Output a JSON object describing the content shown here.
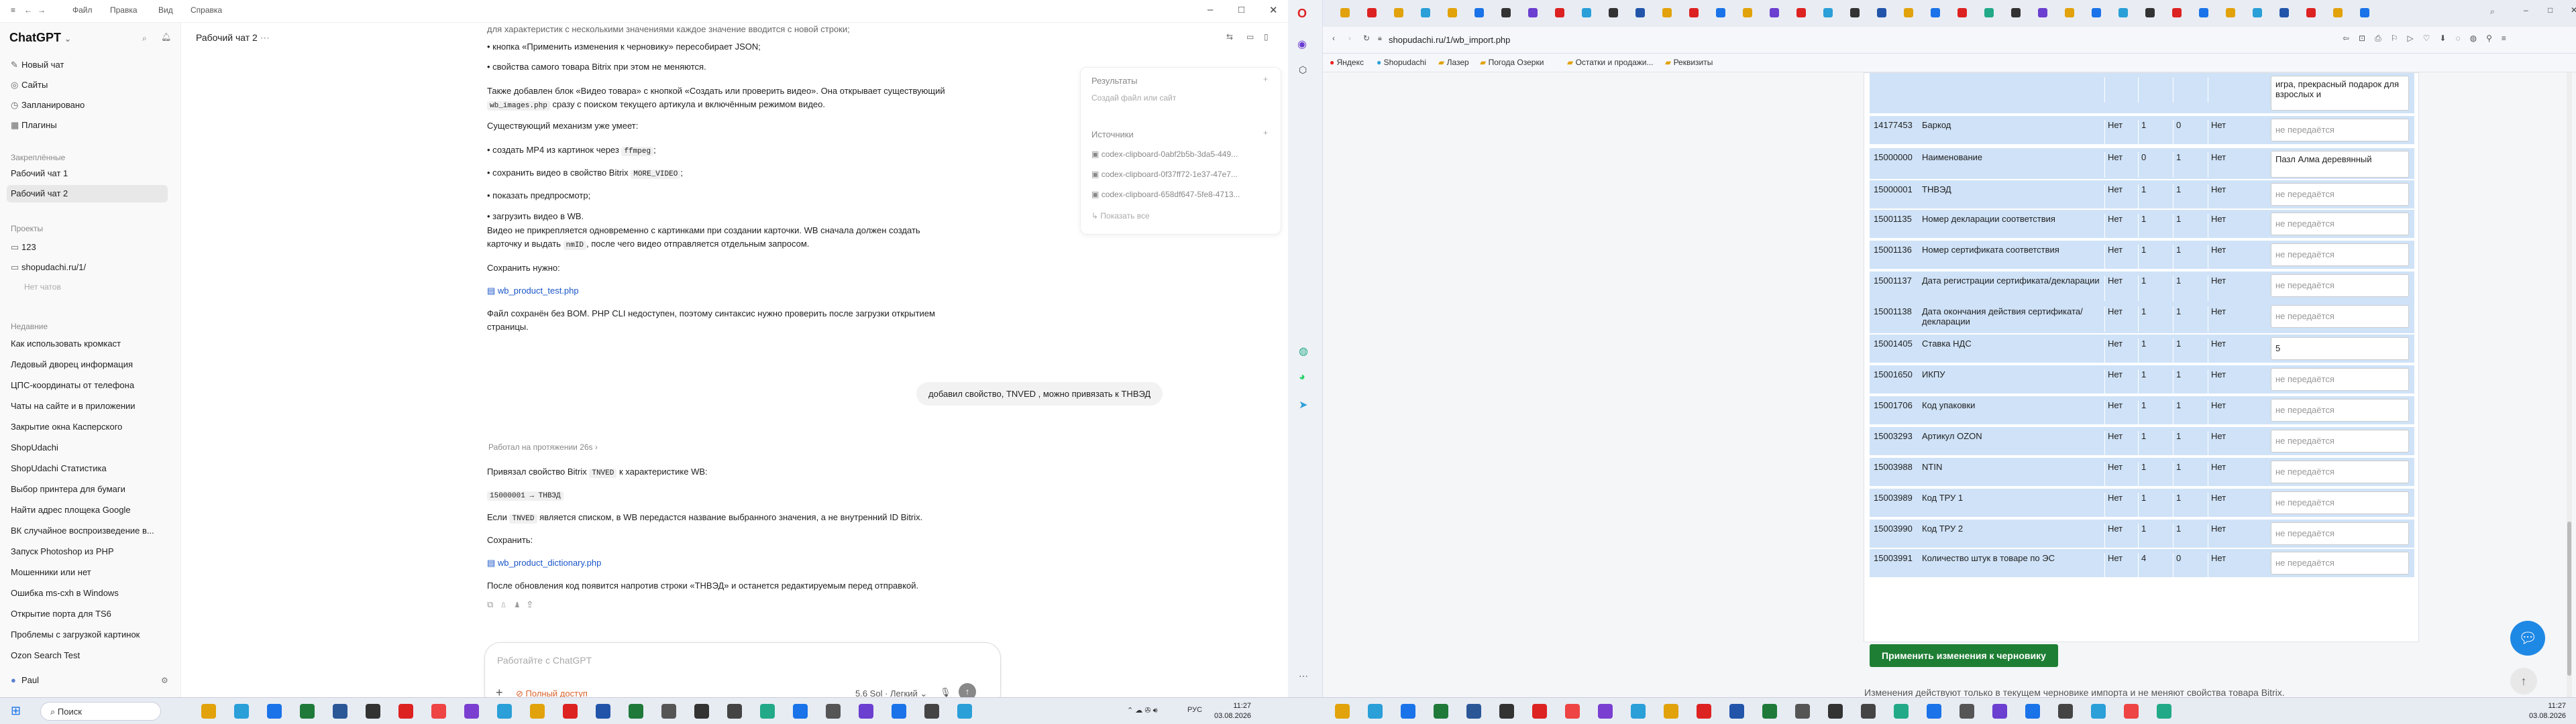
{
  "chat": {
    "app_title": "ChatGPT",
    "menu": [
      "Файл",
      "Правка",
      "Вид",
      "Справка"
    ],
    "sidebar": {
      "logo": "ChatGPT",
      "items": [
        {
          "label": "Новый чат"
        },
        {
          "label": "Сайты"
        },
        {
          "label": "Запланировано"
        },
        {
          "label": "Плагины"
        }
      ],
      "pinned_title": "Закреплённые",
      "pinned": [
        {
          "label": "Рабочий чат 1"
        },
        {
          "label": "Рабочий чат 2"
        }
      ],
      "projects_title": "Проекты",
      "projects": [
        {
          "label": "123"
        },
        {
          "label": "shopudachi.ru/1/"
        }
      ],
      "projects_empty": "Нет чатов",
      "recent_title": "Недавние",
      "recent": [
        "Как использовать кромкаст",
        "Ледовый дворец информация",
        "ЦПС-координаты от телефона",
        "Чаты на сайте и в приложении",
        "Закрытие окна Касперского",
        "ShopUdachi",
        "ShopUdachi Статистика",
        "Выбор принтера для бумаги",
        "Найти адрес площека Google",
        "ВК случайное воспроизведение в...",
        "Запуск Photoshop из PHP",
        "Мошенники или нет",
        "Ошибка ms-cxh в Windows",
        "Открытие порта для TS6",
        "Проблемы с загрузкой картинок",
        "Ozon Search Test"
      ],
      "user": "Paul"
    },
    "header_title": "Рабочий чат 2",
    "messages": {
      "top_line": "для характеристик с несколькими значениями каждое значение вводится с новой строки;",
      "bullets1": [
        "кнопка «Применить изменения к черновику» пересобирает JSON;",
        "свойства самого товара Bitrix при этом не меняются."
      ],
      "para1a": "Также добавлен блок «Видео товара» с кнопкой «Создать или проверить видео». Она открывает существующий",
      "para1b_code": "wb_images.php",
      "para1b_text": " сразу с поиском текущего артикула и включённым режимом видео.",
      "para2": "Существующий механизм уже умеет:",
      "bullets2": [
        {
          "text": "создать MP4 из картинок через ",
          "code": "ffmpeg",
          "tail": ";"
        },
        {
          "text": "сохранить видео в свойство Bitrix ",
          "code": "MORE_VIDEO",
          "tail": ";"
        },
        {
          "text": "показать предпросмотр;",
          "code": "",
          "tail": ""
        },
        {
          "text": "загрузить видео в WB.",
          "code": "",
          "tail": ""
        }
      ],
      "para3a": "Видео не прикрепляется одновременно с картинками при создании карточки. WB сначала должен создать",
      "para3b_pre": "карточку и выдать ",
      "para3b_code": "nmID",
      "para3b_post": ", после чего видео отправляется отдельным запросом.",
      "saved_label": "Сохранить нужно:",
      "file1": "wb_product_test.php",
      "para4": "Файл сохранён без BOM. PHP CLI недоступен, поэтому синтаксис нужно проверить после загрузки открытием страницы.",
      "user_message": "добавил свойство, TNVED , можно привязать к ТНВЭД",
      "worked": "Работал на протяжении 26s",
      "reply1_pre": "Привязал свойство Bitrix ",
      "reply1_code": "TNVED",
      "reply1_post": " к характеристике WB:",
      "reply_code_block": "15000001 → ТНВЭД",
      "reply2_pre": "Если ",
      "reply2_code": "TNVED",
      "reply2_post": " является списком, в WB передастся название выбранного значения, а не внутренний ID Bitrix.",
      "saved_label2": "Сохранить:",
      "file2": "wb_product_dictionary.php",
      "reply3": "После обновления код появится напротив строки «ТНВЭД» и останется редактируемым перед отправкой."
    },
    "composer": {
      "placeholder": "Работайте с ChatGPT",
      "access": "Полный доступ",
      "model": "5.6 Sol · Легкий"
    },
    "right_panel": {
      "results_title": "Результаты",
      "results_hint": "Создай файл или сайт",
      "sources_title": "Источники",
      "sources": [
        "codex-clipboard-0abf2b5b-3da5-449...",
        "codex-clipboard-0f37ff72-1e37-47e7...",
        "codex-clipboard-658df647-5fe8-4713..."
      ],
      "show_all": "Показать все"
    }
  },
  "browser": {
    "url": "shopudachi.ru/1/wb_import.php",
    "bookmarks": [
      "Яндекс",
      "Shopudachi",
      "Лазер",
      "Погода Озерки",
      "Остатки и продажи...",
      "Реквизиты"
    ],
    "table": {
      "rows": [
        {
          "id": "",
          "name": "",
          "req": "",
          "a": "",
          "b": "",
          "c": "",
          "value": "игра, прекрасный подарок для взрослых и",
          "kind": "multi"
        },
        {
          "id": "14177453",
          "name": "Баркод",
          "req": "Нет",
          "a": "1",
          "b": "0",
          "c": "Нет",
          "value": "не передаётся",
          "kind": "empty"
        },
        {
          "id": "15000000",
          "name": "Наименование",
          "req": "Нет",
          "a": "0",
          "b": "1",
          "c": "Нет",
          "value": "Пазл Алма деревянный",
          "kind": "multi"
        },
        {
          "id": "15000001",
          "name": "ТНВЭД",
          "req": "Нет",
          "a": "1",
          "b": "1",
          "c": "Нет",
          "value": "не передаётся",
          "kind": "empty"
        },
        {
          "id": "15001135",
          "name": "Номер декларации соответствия",
          "req": "Нет",
          "a": "1",
          "b": "1",
          "c": "Нет",
          "value": "не передаётся",
          "kind": "empty"
        },
        {
          "id": "15001136",
          "name": "Номер сертификата соответствия",
          "req": "Нет",
          "a": "1",
          "b": "1",
          "c": "Нет",
          "value": "не передаётся",
          "kind": "empty"
        },
        {
          "id": "15001137",
          "name": "Дата регистрации сертификата/декларации",
          "req": "Нет",
          "a": "1",
          "b": "1",
          "c": "Нет",
          "value": "не передаётся",
          "kind": "empty"
        },
        {
          "id": "15001138",
          "name": "Дата окончания действия сертификата/декларации",
          "req": "Нет",
          "a": "1",
          "b": "1",
          "c": "Нет",
          "value": "не передаётся",
          "kind": "empty"
        },
        {
          "id": "15001405",
          "name": "Ставка НДС",
          "req": "Нет",
          "a": "1",
          "b": "1",
          "c": "Нет",
          "value": "5",
          "kind": "filled"
        },
        {
          "id": "15001650",
          "name": "ИКПУ",
          "req": "Нет",
          "a": "1",
          "b": "1",
          "c": "Нет",
          "value": "не передаётся",
          "kind": "empty"
        },
        {
          "id": "15001706",
          "name": "Код упаковки",
          "req": "Нет",
          "a": "1",
          "b": "1",
          "c": "Нет",
          "value": "не передаётся",
          "kind": "empty"
        },
        {
          "id": "15003293",
          "name": "Артикул OZON",
          "req": "Нет",
          "a": "1",
          "b": "1",
          "c": "Нет",
          "value": "не передаётся",
          "kind": "empty"
        },
        {
          "id": "15003988",
          "name": "NTIN",
          "req": "Нет",
          "a": "1",
          "b": "1",
          "c": "Нет",
          "value": "не передаётся",
          "kind": "empty"
        },
        {
          "id": "15003989",
          "name": "Код ТРУ 1",
          "req": "Нет",
          "a": "1",
          "b": "1",
          "c": "Нет",
          "value": "не передаётся",
          "kind": "empty"
        },
        {
          "id": "15003990",
          "name": "Код ТРУ 2",
          "req": "Нет",
          "a": "1",
          "b": "1",
          "c": "Нет",
          "value": "не передаётся",
          "kind": "empty"
        },
        {
          "id": "15003991",
          "name": "Количество штук в товаре по ЭС",
          "req": "Нет",
          "a": "4",
          "b": "0",
          "c": "Нет",
          "value": "не передаётся",
          "kind": "empty"
        }
      ]
    },
    "apply_button": "Применить изменения к черновику",
    "note": "Изменения действуют только в текущем черновике импорта и не меняют свойства товара Bitrix."
  },
  "taskbar": {
    "search": "Поиск",
    "lang": "РУС",
    "time_left": "11:27",
    "date_left": "03.08.2026",
    "time_right": "11:27",
    "date_right": "03.08.2026"
  }
}
